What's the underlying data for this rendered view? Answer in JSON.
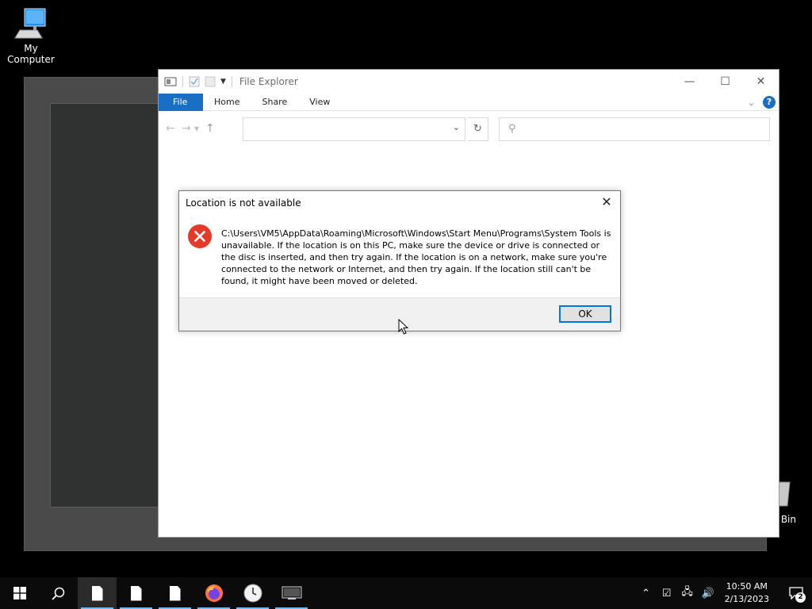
{
  "desktop": {
    "my_computer_label": "My Computer",
    "recycle_bin_label": "Bin"
  },
  "explorer": {
    "title": "File Explorer",
    "ribbon_tabs": [
      "File",
      "Home",
      "Share",
      "View"
    ],
    "help_label": "?",
    "address_value": "",
    "search_placeholder": ""
  },
  "dialog": {
    "title": "Location is not available",
    "message": "C:\\Users\\VM5\\AppData\\Roaming\\Microsoft\\Windows\\Start Menu\\Programs\\System Tools is unavailable. If the location is on this PC, make sure the device or drive is connected or the disc is inserted, and then try again. If the location is on a network, make sure you're connected to the network or Internet, and then try again. If the location still can't be found, it might have been moved or deleted.",
    "ok_label": "OK",
    "icon": "error-icon"
  },
  "taskbar": {
    "time": "10:50 AM",
    "date": "2/13/2023",
    "notification_count": "2",
    "accent_color": "#76b9ed"
  },
  "colors": {
    "ribbon_file_tab": "#1a6fc4",
    "error_icon": "#e53a2a",
    "ok_border": "#0078d7"
  }
}
